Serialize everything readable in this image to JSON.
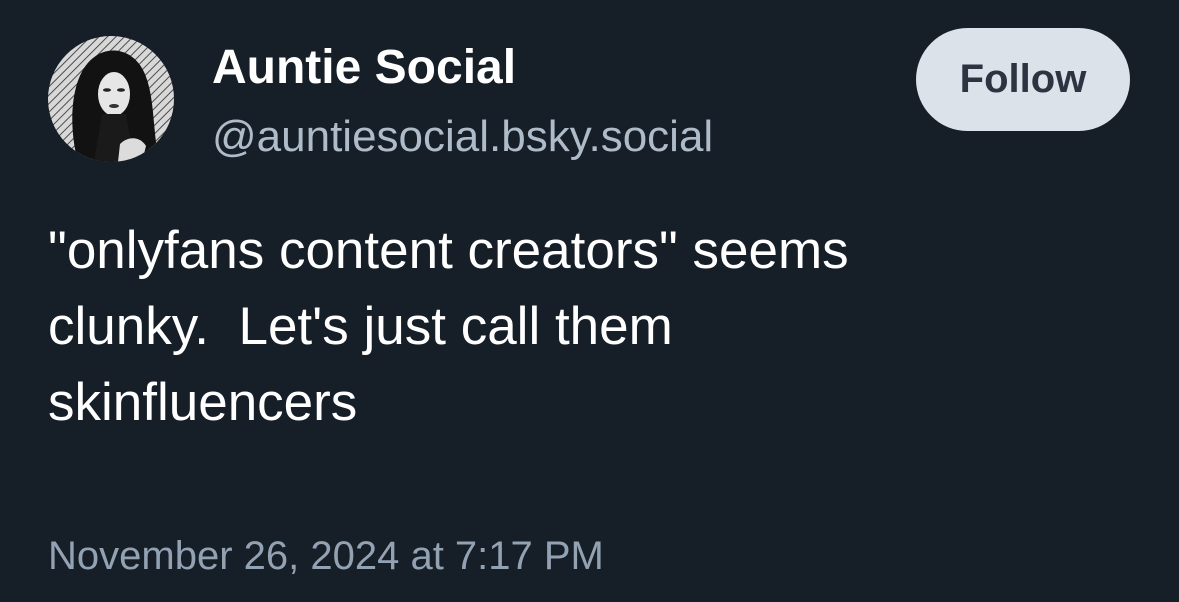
{
  "post": {
    "author": {
      "display_name": "Auntie Social",
      "handle": "@auntiesocial.bsky.social"
    },
    "follow_label": "Follow",
    "text": "\"onlyfans content creators\" seems\nclunky.  Let's just call them\nskinfluencers",
    "timestamp": "November 26, 2024 at 7:17 PM"
  },
  "colors": {
    "background": "#161e27",
    "text_primary": "#ffffff",
    "text_secondary": "#aebbc9",
    "timestamp": "#93a2b3",
    "follow_button_bg": "#dce2ea",
    "follow_button_text": "#2b3440"
  }
}
